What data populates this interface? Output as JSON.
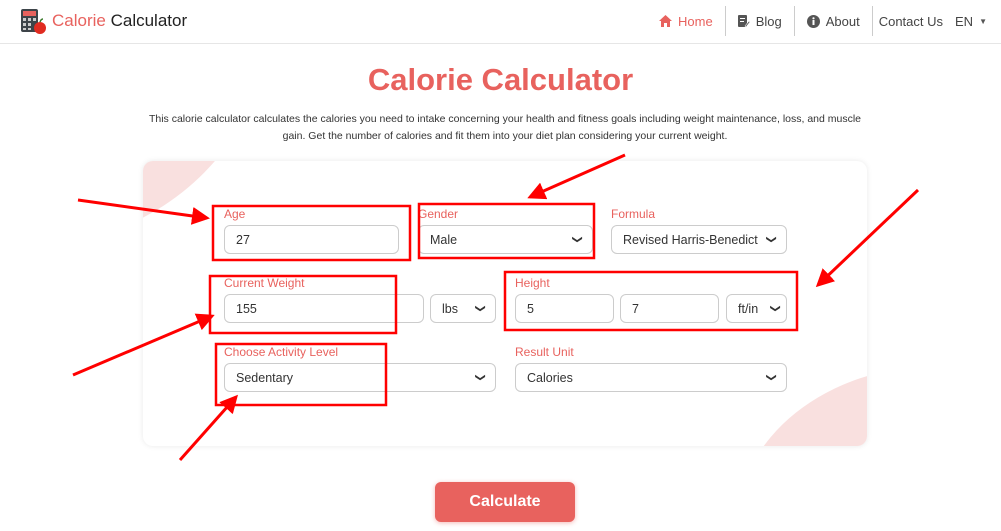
{
  "navbar": {
    "brand_part1": "Calorie",
    "brand_part2": "Calculator",
    "items": [
      {
        "label": "Home",
        "icon": "home-icon",
        "active": true
      },
      {
        "label": "Blog",
        "icon": "edit-note-icon",
        "active": false
      },
      {
        "label": "About",
        "icon": "info-icon",
        "active": false
      },
      {
        "label": "Contact Us",
        "icon": "",
        "active": false
      }
    ],
    "language": "EN"
  },
  "page": {
    "title": "Calorie Calculator",
    "intro": "This calorie calculator calculates the calories you need to intake concerning your health and fitness goals including weight maintenance, loss, and muscle gain. Get the number of calories and fit them into your diet plan considering your current weight."
  },
  "form": {
    "age": {
      "label": "Age",
      "value": "27"
    },
    "gender": {
      "label": "Gender",
      "value": "Male"
    },
    "formula": {
      "label": "Formula",
      "value": "Revised Harris-Benedict"
    },
    "weight": {
      "label": "Current Weight",
      "value": "155",
      "unit": "lbs"
    },
    "height": {
      "label": "Height",
      "feet": "5",
      "inches": "7",
      "unit": "ft/in"
    },
    "activity": {
      "label": "Choose Activity Level",
      "value": "Sedentary"
    },
    "result_unit": {
      "label": "Result Unit",
      "value": "Calories"
    },
    "submit_label": "Calculate"
  },
  "colors": {
    "accent": "#e8625e",
    "annotation": "#ff0000"
  }
}
